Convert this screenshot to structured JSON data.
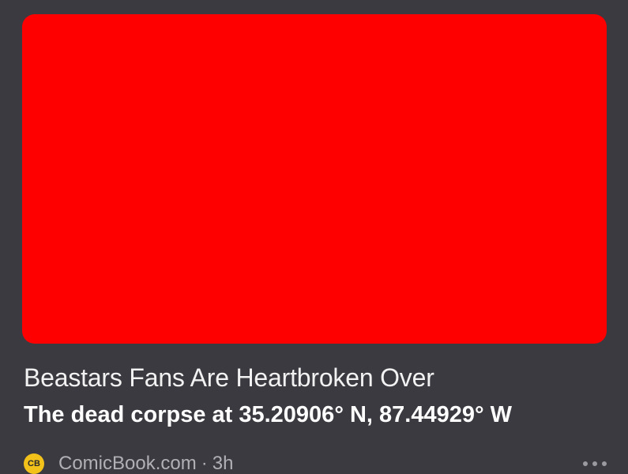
{
  "article": {
    "headline_line1": "Beastars Fans Are Heartbroken Over",
    "headline_line2": "The dead corpse at 35.20906° N, 87.44929° W",
    "thumbnail_color": "#ff0000"
  },
  "source": {
    "logo_text": "CB",
    "name": "ComicBook.com",
    "separator": "·",
    "time": "3h",
    "logo_color": "#f2c21b"
  },
  "actions": {
    "more_icon": "more-horizontal-icon"
  }
}
